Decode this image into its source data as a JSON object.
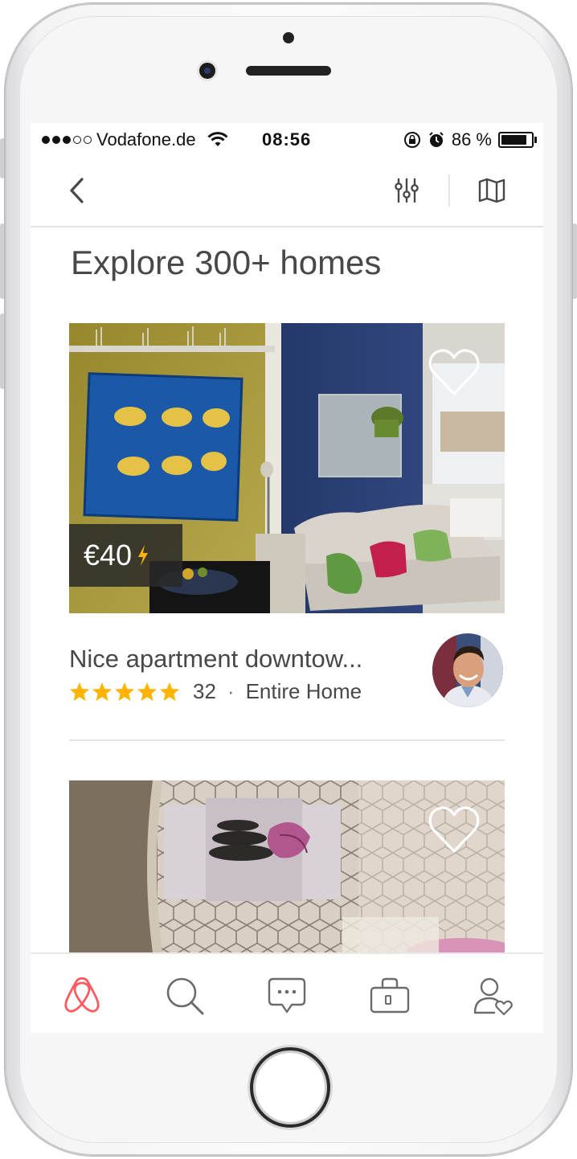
{
  "statusbar": {
    "carrier": "Vodafone.de",
    "time": "08:56",
    "battery_pct": "86 %",
    "battery_level": 0.86,
    "signal_bars_filled": 3,
    "signal_bars_total": 5
  },
  "navbar": {
    "back_icon": "chevron-left-icon",
    "filter_icon": "sliders-icon",
    "map_icon": "map-icon"
  },
  "page_title": "Explore 300+ homes",
  "listings": [
    {
      "price": "€40",
      "instant_book_icon": "lightning-bolt-icon",
      "title": "Nice apartment downtow...",
      "rating_stars": 5,
      "reviews": "32",
      "separator": "·",
      "type": "Entire Home",
      "saved": false
    },
    {
      "saved": false
    }
  ],
  "tabbar": [
    {
      "name": "explore",
      "icon": "airbnb-logo-icon",
      "active": true
    },
    {
      "name": "search",
      "icon": "search-icon",
      "active": false
    },
    {
      "name": "messages",
      "icon": "chat-bubble-icon",
      "active": false
    },
    {
      "name": "trips",
      "icon": "suitcase-icon",
      "active": false
    },
    {
      "name": "profile",
      "icon": "user-heart-icon",
      "active": false
    }
  ],
  "colors": {
    "brand": "#FF5A5F",
    "star": "#FFB400",
    "text": "#484848",
    "icon_gray": "#6b6b6b"
  }
}
